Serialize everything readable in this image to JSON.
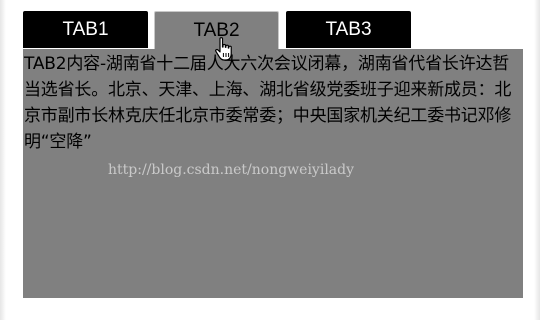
{
  "tabs": [
    {
      "label": "TAB1",
      "active": false
    },
    {
      "label": "TAB2",
      "active": true
    },
    {
      "label": "TAB3",
      "active": false
    }
  ],
  "panel": {
    "content": "TAB2内容-湖南省十二届人大六次会议闭幕，湖南省代省长许达哲当选省长。北京、天津、上海、湖北省级党委班子迎来新成员：北京市副市长林克庆任北京市委常委；中央国家机关纪工委书记邓修明“空降”"
  },
  "watermark": {
    "text": "http://blog.csdn.net/nongweiyilady"
  },
  "colors": {
    "tab_inactive_bg": "#000000",
    "tab_inactive_text": "#ffffff",
    "tab_active_bg": "#808080",
    "panel_bg": "#808080"
  },
  "icons": {
    "cursor": "hand-pointer-cursor-icon"
  }
}
